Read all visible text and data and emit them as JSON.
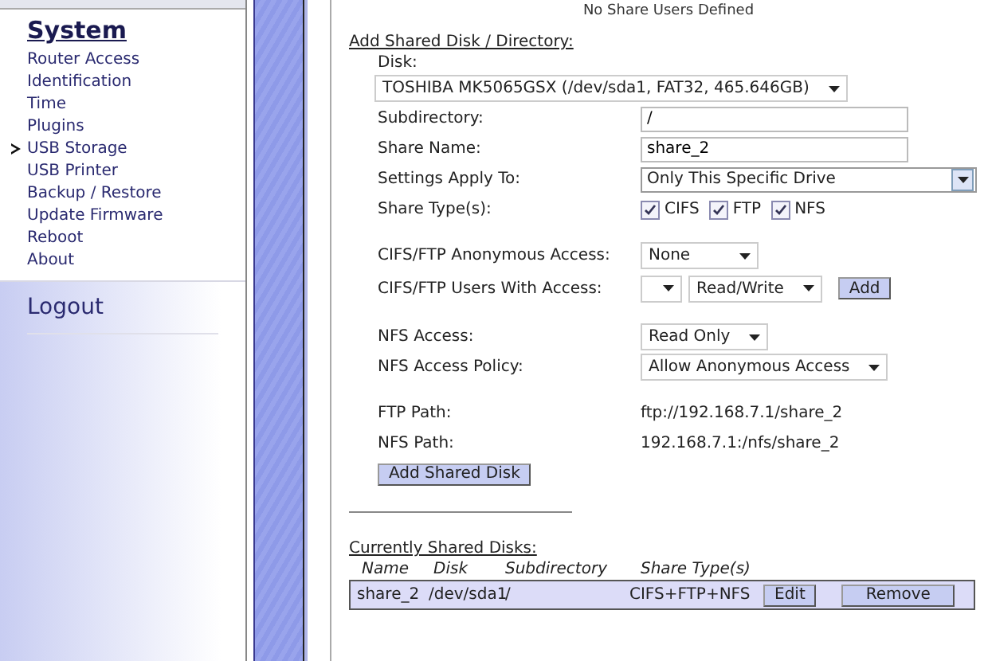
{
  "sidebar": {
    "title": "System",
    "items": [
      {
        "label": "Router Access",
        "selected": false
      },
      {
        "label": "Identification",
        "selected": false
      },
      {
        "label": "Time",
        "selected": false
      },
      {
        "label": "Plugins",
        "selected": false
      },
      {
        "label": "USB Storage",
        "selected": true
      },
      {
        "label": "USB Printer",
        "selected": false
      },
      {
        "label": "Backup / Restore",
        "selected": false
      },
      {
        "label": "Update Firmware",
        "selected": false
      },
      {
        "label": "Reboot",
        "selected": false
      },
      {
        "label": "About",
        "selected": false
      }
    ],
    "logout": "Logout"
  },
  "notice": "No Share Users Defined",
  "add_section": {
    "heading": "Add Shared Disk / Directory:",
    "disk": {
      "label": "Disk:",
      "value": "TOSHIBA MK5065GSX (/dev/sda1, FAT32, 465.646GB)"
    },
    "groups": [
      [
        {
          "kind": "input",
          "label": "Subdirectory:",
          "value": "/"
        },
        {
          "kind": "input",
          "label": "Share Name:",
          "value": "share_2"
        },
        {
          "kind": "combobox",
          "label": "Settings Apply To:",
          "value": "Only This Specific Drive"
        },
        {
          "kind": "checkboxes",
          "label": "Share Type(s):",
          "options": [
            {
              "label": "CIFS",
              "checked": true
            },
            {
              "label": "FTP",
              "checked": true
            },
            {
              "label": "NFS",
              "checked": true
            }
          ]
        }
      ],
      [
        {
          "kind": "select",
          "label": "CIFS/FTP Anonymous Access:",
          "value": "None"
        },
        {
          "kind": "user_access",
          "label": "CIFS/FTP Users With Access:",
          "permission": "Read/Write",
          "button": "Add"
        }
      ],
      [
        {
          "kind": "select",
          "label": "NFS Access:",
          "value": "Read Only"
        },
        {
          "kind": "select",
          "label": "NFS Access Policy:",
          "value": "Allow Anonymous Access"
        }
      ],
      [
        {
          "kind": "text",
          "label": "FTP Path:",
          "value": "ftp://192.168.7.1/share_2"
        },
        {
          "kind": "text",
          "label": "NFS Path:",
          "value": "192.168.7.1:/nfs/share_2"
        }
      ]
    ],
    "button": "Add Shared Disk"
  },
  "current": {
    "heading": "Currently Shared Disks:",
    "columns": [
      "Name",
      "Disk",
      "Subdirectory",
      "Share Type(s)"
    ],
    "rows": [
      {
        "name": "share_2",
        "disk": "/dev/sda1",
        "subdirectory": "/",
        "share_types": "CIFS+FTP+NFS",
        "edit": "Edit",
        "remove": "Remove"
      }
    ]
  }
}
